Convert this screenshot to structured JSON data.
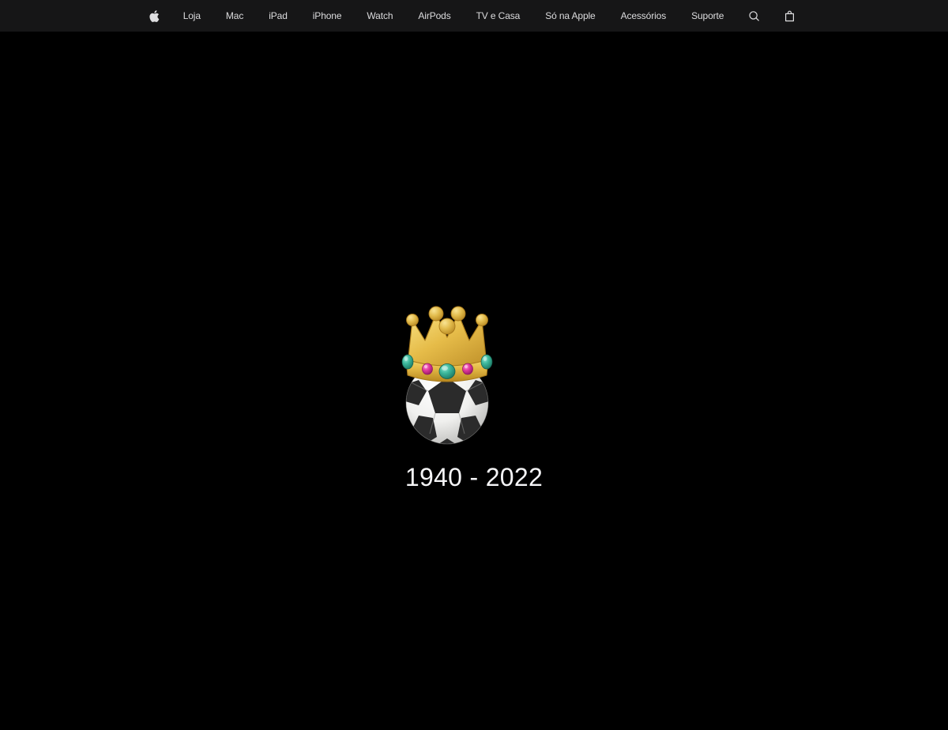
{
  "page": {
    "title": "Apple",
    "background_color": "#000000",
    "language": "pt-BR"
  },
  "globalnav": {
    "background_color": "#161617",
    "text_color": "#f5f5f7",
    "apple_logo_label": "Apple",
    "items": [
      {
        "label": "Loja",
        "name": "loja"
      },
      {
        "label": "Mac",
        "name": "mac"
      },
      {
        "label": "iPad",
        "name": "ipad"
      },
      {
        "label": "iPhone",
        "name": "iphone"
      },
      {
        "label": "Watch",
        "name": "watch"
      },
      {
        "label": "AirPods",
        "name": "airpods"
      },
      {
        "label": "TV e Casa",
        "name": "tv-e-casa"
      },
      {
        "label": "Só na Apple",
        "name": "so-na-apple"
      },
      {
        "label": "Acessórios",
        "name": "acessorios"
      },
      {
        "label": "Suporte",
        "name": "suporte"
      }
    ],
    "search": {
      "icon": "search-icon",
      "label": "Pesquisar no apple.com"
    },
    "bag": {
      "icon": "shopping-bag-icon",
      "label": "Sacola"
    }
  },
  "memorial": {
    "emoji": {
      "name": "crowned-soccer-ball",
      "glyphs": [
        "crown-emoji",
        "soccer-ball-emoji"
      ],
      "colors": {
        "crown_gold_light": "#f2cf56",
        "crown_gold": "#e0b040",
        "crown_gold_dark": "#b98a24",
        "gem_teal": "#3cb79b",
        "gem_magenta": "#e0399e",
        "ball_white": "#f2f2f0",
        "ball_black": "#2b2b2b"
      }
    },
    "dates": "1940 - 2022",
    "dates_color": "#f5f5f7"
  }
}
